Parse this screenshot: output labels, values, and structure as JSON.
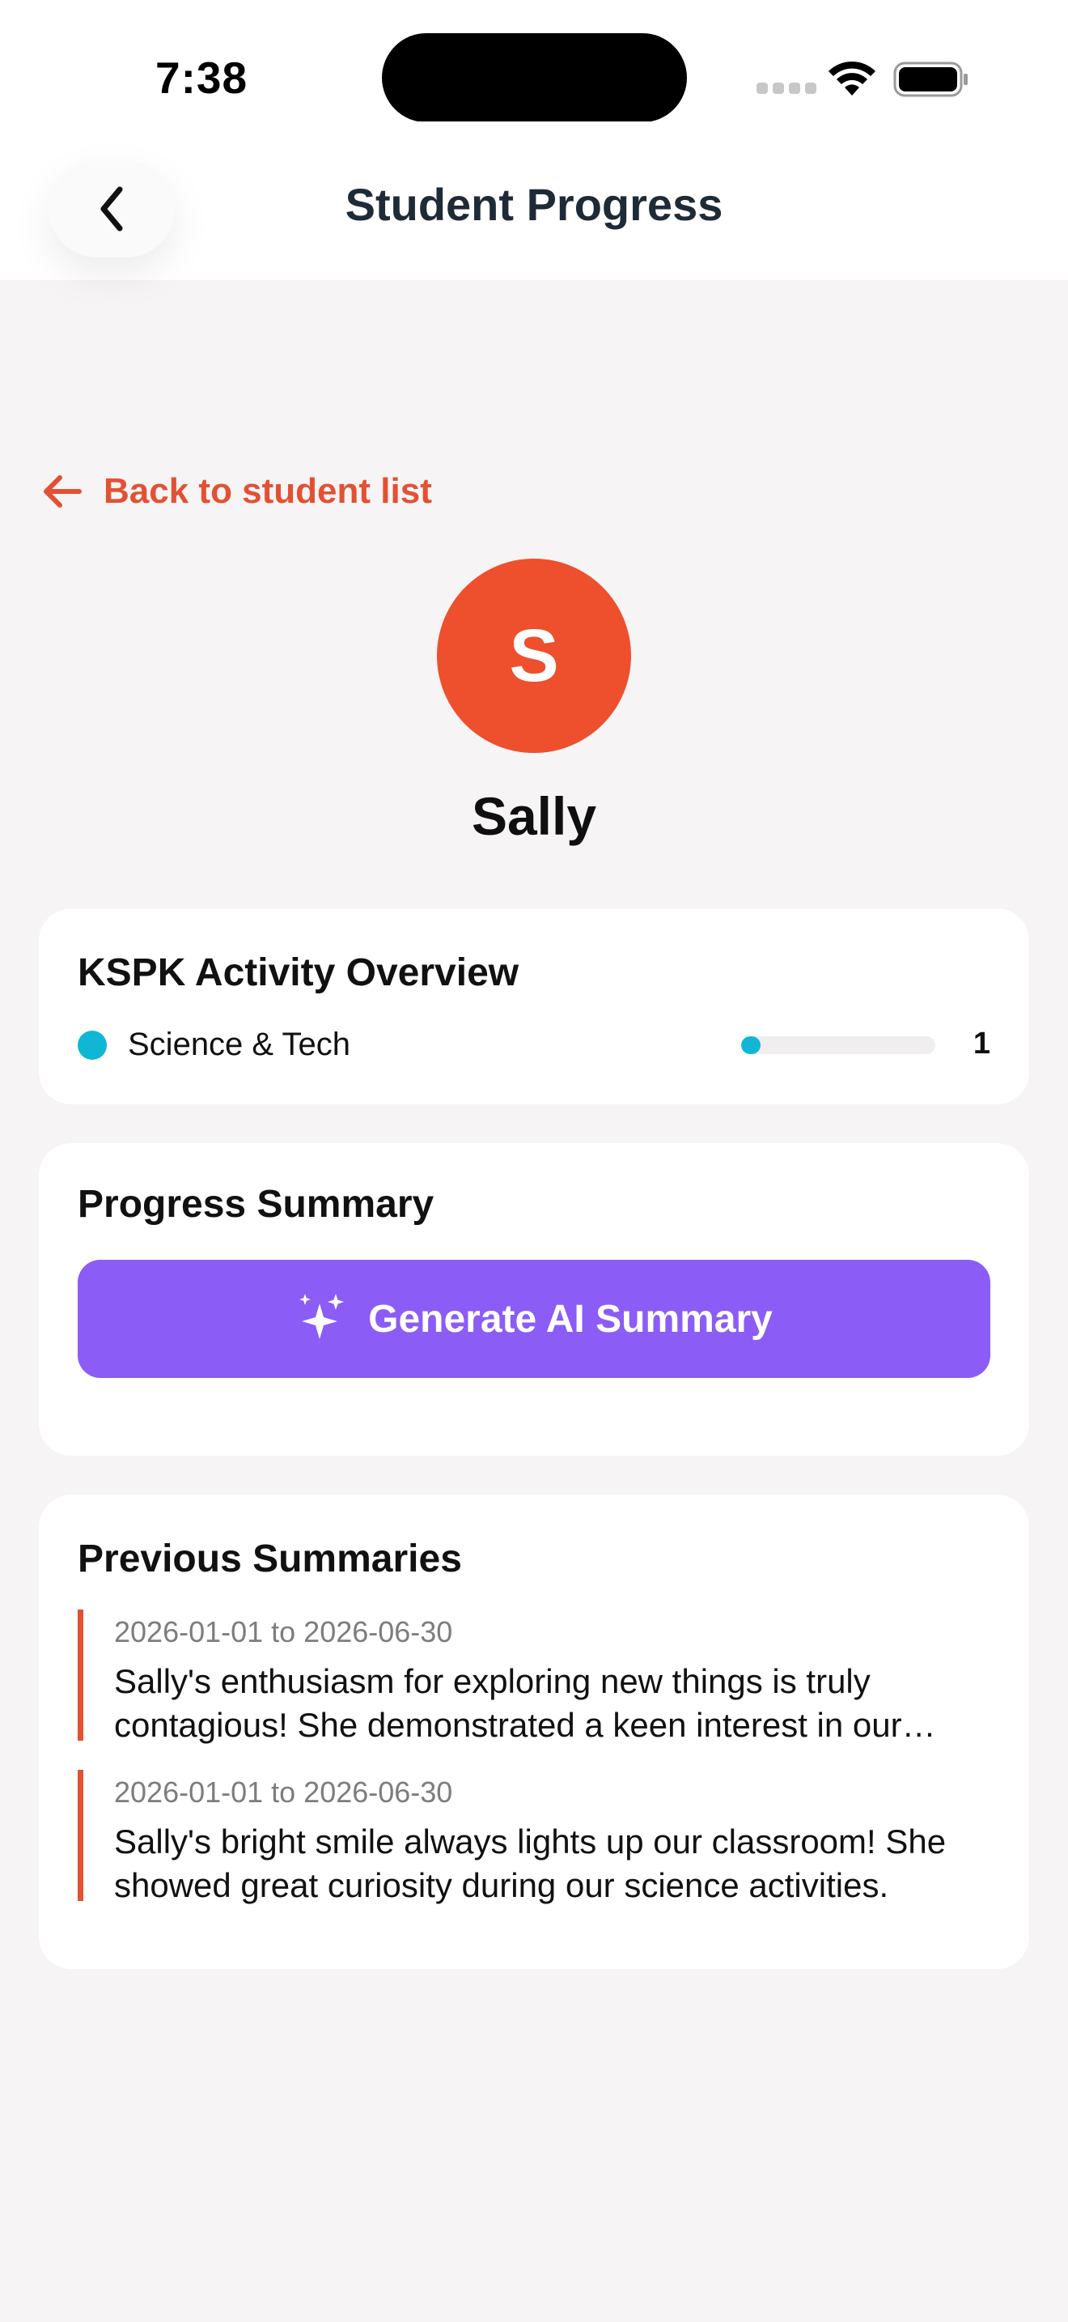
{
  "status_bar": {
    "time": "7:38"
  },
  "header": {
    "title": "Student Progress"
  },
  "back_link": {
    "label": "Back to student list"
  },
  "student": {
    "initial": "S",
    "name": "Sally"
  },
  "activity_overview": {
    "title": "KSPK Activity Overview",
    "items": [
      {
        "label": "Science & Tech",
        "count": "1",
        "fraction": 0.1,
        "color": "#0fb7d4"
      }
    ]
  },
  "progress_summary": {
    "title": "Progress Summary",
    "button_label": "Generate AI Summary"
  },
  "previous_summaries": {
    "title": "Previous Summaries",
    "items": [
      {
        "date_range": "2026-01-01 to 2026-06-30",
        "text": "Sally's enthusiasm for exploring new things is truly contagious! She demonstrated a keen interest in our science activities."
      },
      {
        "date_range": "2026-01-01 to 2026-06-30",
        "text": "Sally's bright smile always lights up our classroom! She showed great curiosity during our science activities."
      }
    ]
  },
  "colors": {
    "accent": "#e25133",
    "avatar": "#ee4f2d",
    "ai_button": "#8b5cf6",
    "science_tech": "#0fb7d4"
  }
}
